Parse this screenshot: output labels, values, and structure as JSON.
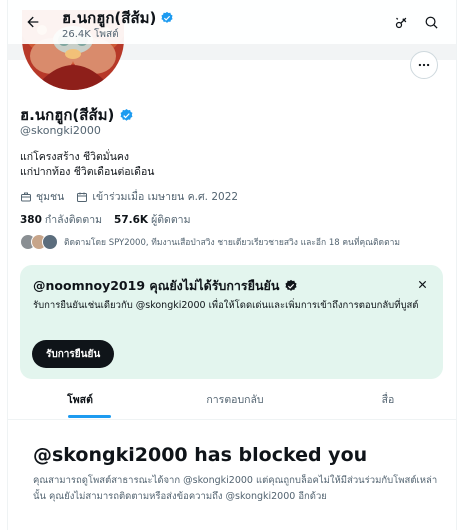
{
  "header": {
    "name": "ฮ.นกฮูก(สีส้ม)",
    "posts_count": "26.4K โพสต์"
  },
  "profile": {
    "display_name": "ฮ.นกฮูก(สีส้ม)",
    "handle": "@skongki2000",
    "bio_line1": "แก่โครงสร้าง ชีวิตมั่นคง",
    "bio_line2": "แก่ปากท้อง ชีวิตเดือนต่อเดือน",
    "category": "ชุมชน",
    "joined": "เข้าร่วมเมื่อ เมษายน ค.ศ. 2022",
    "following_count": "380",
    "following_label": "กำลังติดตาม",
    "followers_count": "57.6K",
    "followers_label": "ผู้ติดตาม",
    "followed_by": "ติดตามโดย SPY2000, ทีมงานเสือป่าสวิง ชายเดียวเรียวชายสวิง และอีก 18 คนที่คุณติดตาม"
  },
  "verify_card": {
    "title": "@noomnoy2019 คุณยังไม่ได้รับการยืนยัน",
    "body": "รับการยืนยันเช่นเดียวกับ @skongki2000 เพื่อให้โดดเด่นและเพิ่มการเข้าถึงการตอบกลับที่บูสต์",
    "button": "รับการยืนยัน"
  },
  "tabs": [
    {
      "label": "โพสต์"
    },
    {
      "label": "การตอบกลับ"
    },
    {
      "label": "สื่อ"
    }
  ],
  "blocked": {
    "title": "@skongki2000 has blocked you",
    "body": "คุณสามารถดูโพสต์สาธารณะได้จาก @skongki2000 แต่คุณถูกบล็อคไม่ให้มีส่วนร่วมกับโพสต์เหล่านั้น คุณยังไม่สามารถติดตามหรือส่งข้อความถึง @skongki2000 อีกด้วย"
  },
  "colors": {
    "accent": "#1d9bf0",
    "verified_badge": "#1d9bf0",
    "verify_card_bg": "#e3f5ee",
    "text_primary": "#0f1419",
    "text_secondary": "#536471"
  },
  "icons": [
    "back-arrow-icon",
    "vpn-key-icon",
    "search-icon",
    "more-icon",
    "verified-badge-icon",
    "briefcase-icon",
    "calendar-icon",
    "close-icon",
    "black-verified-icon"
  ]
}
